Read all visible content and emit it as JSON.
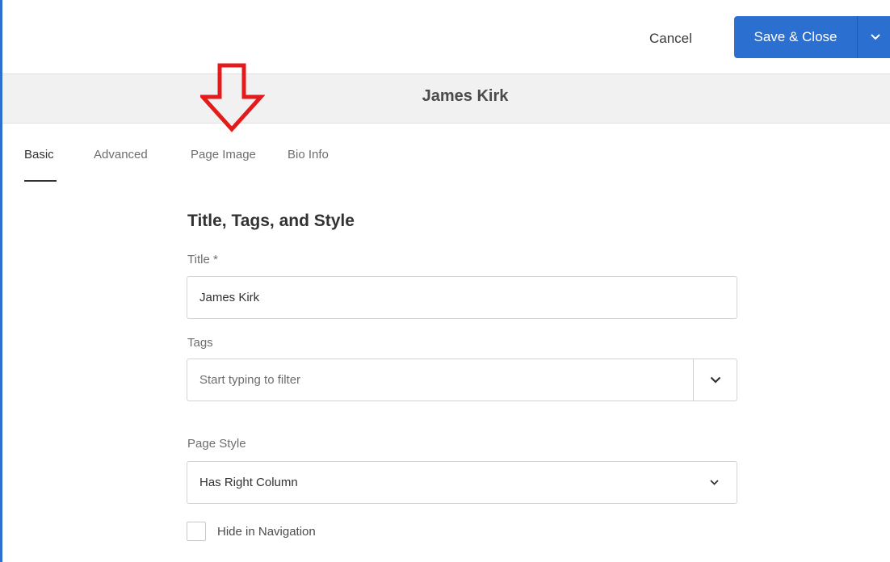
{
  "toolbar": {
    "cancel_label": "Cancel",
    "save_label": "Save & Close",
    "accent_color": "#2b6fd0"
  },
  "header": {
    "title": "James Kirk"
  },
  "tabs": [
    {
      "label": "Basic",
      "active": true
    },
    {
      "label": "Advanced",
      "active": false
    },
    {
      "label": "Page Image",
      "active": false
    },
    {
      "label": "Bio Info",
      "active": false
    }
  ],
  "annotation": {
    "icon": "arrow-down-icon",
    "color": "#e31b1b"
  },
  "form": {
    "section_title": "Title, Tags, and Style",
    "title_label": "Title *",
    "title_value": "James Kirk",
    "tags_label": "Tags",
    "tags_placeholder": "Start typing to filter",
    "page_style_label": "Page Style",
    "page_style_value": "Has Right Column",
    "hide_nav_label": "Hide in Navigation",
    "hide_nav_checked": false
  }
}
